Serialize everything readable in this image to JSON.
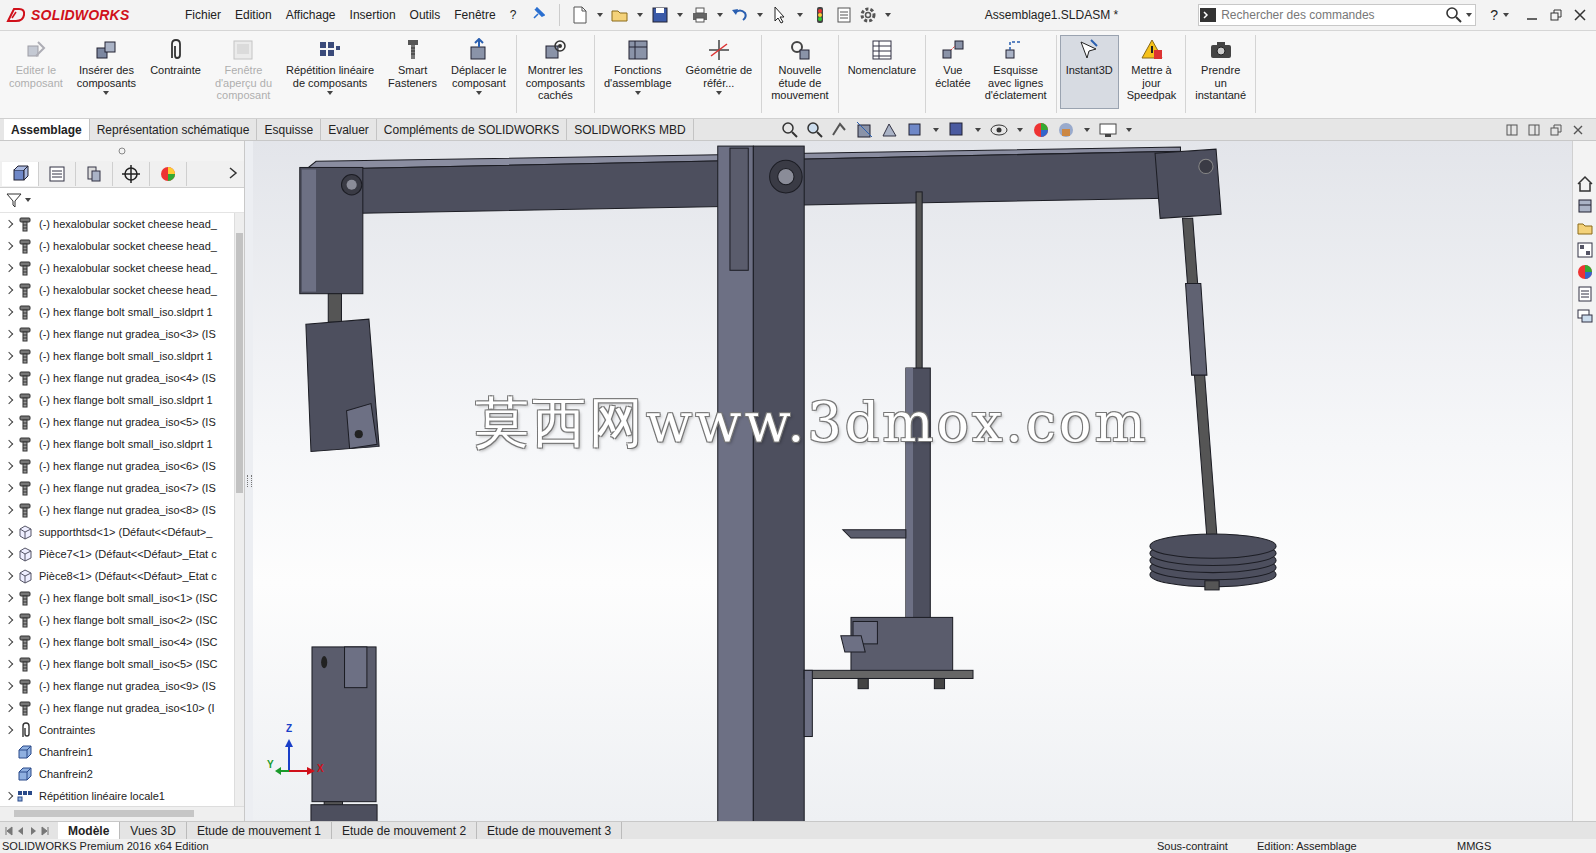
{
  "window": {
    "logo": "SOLIDWORKS",
    "title": "Assemblage1.SLDASM *",
    "help": "?"
  },
  "menu": [
    "Fichier",
    "Edition",
    "Affichage",
    "Insertion",
    "Outils",
    "Fenêtre",
    "?"
  ],
  "search": {
    "placeholder": "Rechercher des commandes"
  },
  "ribbon": {
    "groups": [
      [
        {
          "label": "Editer le\ncomposant",
          "disabled": true,
          "dropdown": false,
          "selected": false
        },
        {
          "label": "Insérer des\ncomposants",
          "disabled": false,
          "dropdown": true,
          "selected": false
        },
        {
          "label": "Contrainte",
          "disabled": false,
          "dropdown": false,
          "selected": false
        },
        {
          "label": "Fenêtre\nd'aperçu du\ncomposant",
          "disabled": true,
          "dropdown": false,
          "selected": false
        },
        {
          "label": "Répétition linéaire\nde composants",
          "disabled": false,
          "dropdown": true,
          "selected": false
        },
        {
          "label": "Smart\nFasteners",
          "disabled": false,
          "dropdown": false,
          "selected": false
        },
        {
          "label": "Déplacer le\ncomposant",
          "disabled": false,
          "dropdown": true,
          "selected": false
        }
      ],
      [
        {
          "label": "Montrer les\ncomposants\ncachés",
          "disabled": false,
          "dropdown": false,
          "selected": false
        }
      ],
      [
        {
          "label": "Fonctions\nd'assemblage",
          "disabled": false,
          "dropdown": true,
          "selected": false
        },
        {
          "label": "Géométrie de\nréfér...",
          "disabled": false,
          "dropdown": true,
          "selected": false
        }
      ],
      [
        {
          "label": "Nouvelle\nétude de\nmouvement",
          "disabled": false,
          "dropdown": false,
          "selected": false
        }
      ],
      [
        {
          "label": "Nomenclature",
          "disabled": false,
          "dropdown": false,
          "selected": false
        }
      ],
      [
        {
          "label": "Vue\néclatée",
          "disabled": false,
          "dropdown": false,
          "selected": false
        },
        {
          "label": "Esquisse\navec lignes\nd'éclatement",
          "disabled": false,
          "dropdown": false,
          "selected": false
        }
      ],
      [
        {
          "label": "Instant3D",
          "disabled": false,
          "dropdown": false,
          "selected": true
        },
        {
          "label": "Mettre à\njour\nSpeedpak",
          "disabled": false,
          "dropdown": false,
          "selected": false
        }
      ],
      [
        {
          "label": "Prendre\nun\ninstantané",
          "disabled": false,
          "dropdown": false,
          "selected": false
        }
      ]
    ]
  },
  "command_tabs": [
    {
      "label": "Assemblage",
      "selected": true
    },
    {
      "label": "Représentation schématique",
      "selected": false
    },
    {
      "label": "Esquisse",
      "selected": false
    },
    {
      "label": "Evaluer",
      "selected": false
    },
    {
      "label": "Compléments de SOLIDWORKS",
      "selected": false
    },
    {
      "label": "SOLIDWORKS MBD",
      "selected": false
    }
  ],
  "tree": {
    "items": [
      {
        "label": "(-) hexalobular socket cheese head_",
        "kind": "fastener",
        "expandable": true
      },
      {
        "label": "(-) hexalobular socket cheese head_",
        "kind": "fastener",
        "expandable": true
      },
      {
        "label": "(-) hexalobular socket cheese head_",
        "kind": "fastener",
        "expandable": true
      },
      {
        "label": "(-) hexalobular socket cheese head_",
        "kind": "fastener",
        "expandable": true
      },
      {
        "label": "(-) hex flange bolt small_iso.sldprt 1",
        "kind": "fastener",
        "expandable": true
      },
      {
        "label": "(-) hex flange nut gradea_iso<3> (IS",
        "kind": "fastener",
        "expandable": true
      },
      {
        "label": "(-) hex flange bolt small_iso.sldprt 1",
        "kind": "fastener",
        "expandable": true
      },
      {
        "label": "(-) hex flange nut gradea_iso<4> (IS",
        "kind": "fastener",
        "expandable": true
      },
      {
        "label": "(-) hex flange bolt small_iso.sldprt 1",
        "kind": "fastener",
        "expandable": true
      },
      {
        "label": "(-) hex flange nut gradea_iso<5> (IS",
        "kind": "fastener",
        "expandable": true
      },
      {
        "label": "(-) hex flange bolt small_iso.sldprt 1",
        "kind": "fastener",
        "expandable": true
      },
      {
        "label": "(-) hex flange nut gradea_iso<6> (IS",
        "kind": "fastener",
        "expandable": true
      },
      {
        "label": "(-) hex flange nut gradea_iso<7> (IS",
        "kind": "fastener",
        "expandable": true
      },
      {
        "label": "(-) hex flange nut gradea_iso<8> (IS",
        "kind": "fastener",
        "expandable": true
      },
      {
        "label": "supporthtsd<1> (Défaut<<Défaut>_",
        "kind": "part",
        "expandable": true
      },
      {
        "label": "Pièce7<1> (Défaut<<Défaut>_Etat c",
        "kind": "part",
        "expandable": true
      },
      {
        "label": "Pièce8<1> (Défaut<<Défaut>_Etat c",
        "kind": "part",
        "expandable": true
      },
      {
        "label": "(-) hex flange bolt small_iso<1> (ISC",
        "kind": "fastener",
        "expandable": true
      },
      {
        "label": "(-) hex flange bolt small_iso<2> (ISC",
        "kind": "fastener",
        "expandable": true
      },
      {
        "label": "(-) hex flange bolt small_iso<4> (ISC",
        "kind": "fastener",
        "expandable": true
      },
      {
        "label": "(-) hex flange bolt small_iso<5> (ISC",
        "kind": "fastener",
        "expandable": true
      },
      {
        "label": "(-) hex flange nut gradea_iso<9> (IS",
        "kind": "fastener",
        "expandable": true
      },
      {
        "label": "(-) hex flange nut gradea_iso<10> (I",
        "kind": "fastener",
        "expandable": true
      },
      {
        "label": "Contraintes",
        "kind": "mates",
        "expandable": true
      },
      {
        "label": "Chanfrein1",
        "kind": "feature",
        "expandable": false
      },
      {
        "label": "Chanfrein2",
        "kind": "feature",
        "expandable": false
      },
      {
        "label": "Répétition linéaire locale1",
        "kind": "pattern",
        "expandable": true
      }
    ]
  },
  "viewport": {
    "watermark": "莫西网www.3dmox.com",
    "triad": {
      "x": "X",
      "y": "Y",
      "z": "Z"
    }
  },
  "bottom_tabs": [
    {
      "label": "Modèle",
      "selected": true
    },
    {
      "label": "Vues 3D",
      "selected": false
    },
    {
      "label": "Etude de mouvement 1",
      "selected": false
    },
    {
      "label": "Etude de mouvement 2",
      "selected": false
    },
    {
      "label": "Etude de mouvement 3",
      "selected": false
    }
  ],
  "status_bar": [
    "SOLIDWORKS Premium 2016 x64 Edition",
    "Sous-contraint",
    "Edition: Assemblage",
    "MMGS"
  ]
}
